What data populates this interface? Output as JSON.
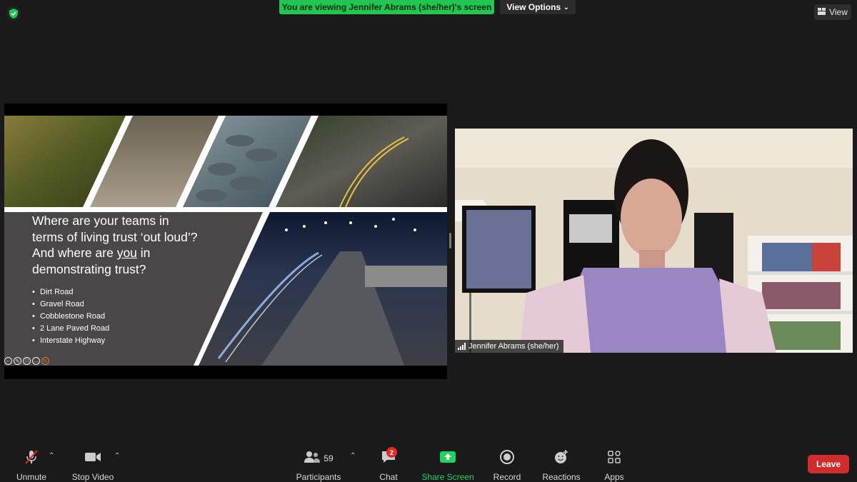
{
  "top": {
    "viewing_banner": "You are viewing Jennifer Abrams (she/her)'s screen",
    "view_options": "View Options",
    "view_button": "View"
  },
  "slide": {
    "question_line1": "Where are your teams in",
    "question_line2": "terms of living trust ‘out loud’?",
    "question_line3_pre": "And where are ",
    "question_line3_u": "you",
    "question_line3_post": " in",
    "question_line4": "demonstrating trust?",
    "bullets": [
      "Dirt Road",
      "Gravel Road",
      "Cobblestone Road",
      "2 Lane Paved Road",
      "Interstate Highway"
    ],
    "controls": [
      "←",
      "✎",
      "□",
      "…",
      "↻"
    ]
  },
  "video": {
    "participant_name": "Jennifer Abrams (she/her)"
  },
  "toolbar": {
    "unmute": "Unmute",
    "stop_video": "Stop Video",
    "participants": "Participants",
    "participants_count": "59",
    "chat": "Chat",
    "chat_badge": "2",
    "share_screen": "Share Screen",
    "record": "Record",
    "reactions": "Reactions",
    "apps": "Apps",
    "leave": "Leave"
  },
  "colors": {
    "banner_green": "#23c552",
    "share_green": "#23d160",
    "leave_red": "#d12c2c",
    "slide_panel": "#4a4749"
  },
  "icons": {
    "shield": "shield-check-icon",
    "view": "grid-view-icon",
    "mic": "microphone-muted-icon",
    "video": "video-camera-icon",
    "participants": "people-icon",
    "chat": "chat-bubble-icon",
    "share": "share-arrow-icon",
    "record": "record-icon",
    "reactions": "smiley-plus-icon",
    "apps": "apps-icon"
  }
}
